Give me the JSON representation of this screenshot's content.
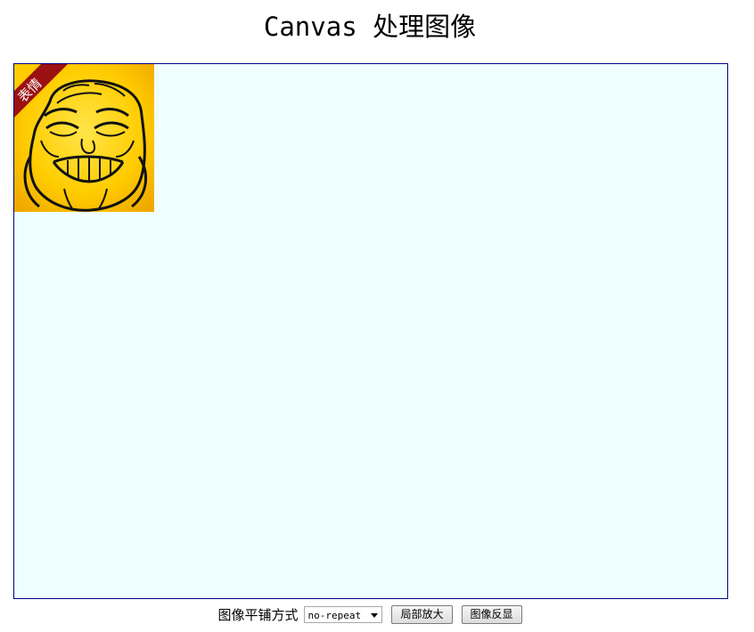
{
  "page": {
    "title": "Canvas 处理图像"
  },
  "canvas": {
    "background": "#f0ffff",
    "border_color": "#000080",
    "image": {
      "icon": "rage-face-emoji-icon",
      "ribbon_text": "表情",
      "ribbon_color": "#9b1111",
      "face_color": "#ffd21a"
    }
  },
  "controls": {
    "tiling_label": "图像平铺方式",
    "tiling_select_value": "no-repeat",
    "zoom_button_label": "局部放大",
    "invert_button_label": "图像反显"
  }
}
